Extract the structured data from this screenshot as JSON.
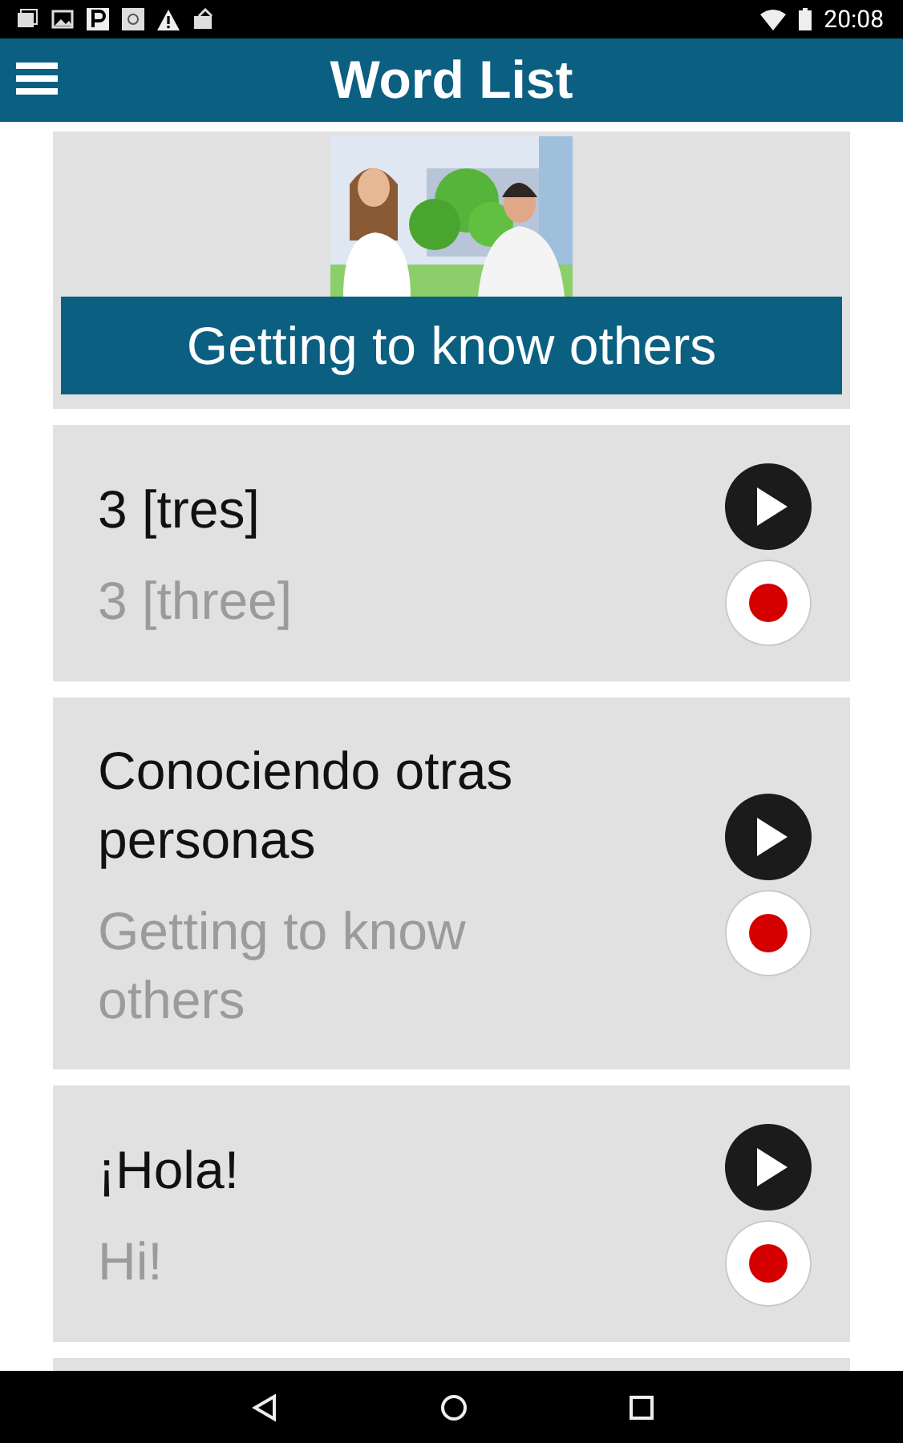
{
  "status_bar": {
    "time": "20:08"
  },
  "header": {
    "title": "Word List"
  },
  "topic": {
    "title": "Getting to know others"
  },
  "words": [
    {
      "phrase": "3 [tres]",
      "translation": "3 [three]"
    },
    {
      "phrase": "Conociendo otras personas",
      "translation": "Getting to know others"
    },
    {
      "phrase": "¡Hola!",
      "translation": "Hi!"
    }
  ]
}
